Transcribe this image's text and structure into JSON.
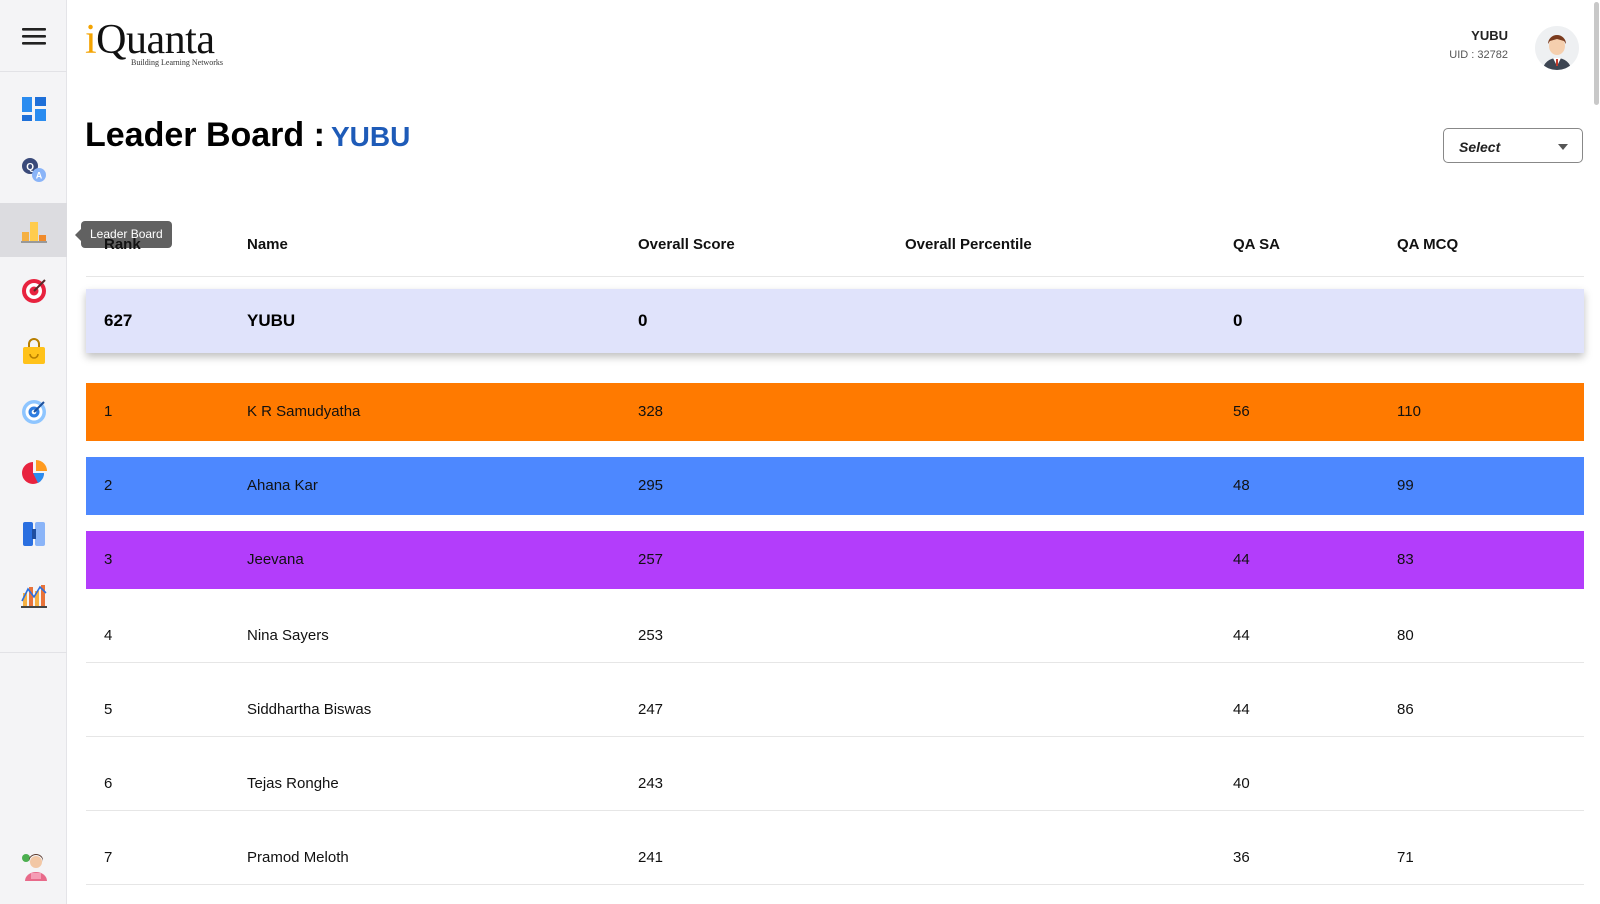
{
  "app": {
    "logo_letter": "i",
    "logo_rest": "Quanta",
    "logo_tagline": "Building Learning Networks"
  },
  "user": {
    "name": "YUBU",
    "uid": "UID : 32782"
  },
  "page": {
    "title": "Leader Board :",
    "user_label": "YUBU"
  },
  "filter": {
    "label": "Select"
  },
  "tooltip": "Leader Board",
  "colors": {
    "first": "#ff7a00",
    "second": "#4d88ff",
    "third": "#b33dfb",
    "accent": "#1e5bb8",
    "highlight": "#e0e3fb"
  },
  "columns": [
    "Rank",
    "Name",
    "Overall Score",
    "Overall Percentile",
    "QA SA",
    "QA MCQ"
  ],
  "my_row": {
    "rank": "627",
    "name": "YUBU",
    "score": "0",
    "percentile": "",
    "qa_sa": "0",
    "qa_mcq": ""
  },
  "rows": [
    {
      "rank": "1",
      "name": "K R Samudyatha",
      "score": "328",
      "percentile": "",
      "qa_sa": "56",
      "qa_mcq": "110"
    },
    {
      "rank": "2",
      "name": "Ahana Kar",
      "score": "295",
      "percentile": "",
      "qa_sa": "48",
      "qa_mcq": "99"
    },
    {
      "rank": "3",
      "name": "Jeevana",
      "score": "257",
      "percentile": "",
      "qa_sa": "44",
      "qa_mcq": "83"
    },
    {
      "rank": "4",
      "name": "Nina Sayers",
      "score": "253",
      "percentile": "",
      "qa_sa": "44",
      "qa_mcq": "80"
    },
    {
      "rank": "5",
      "name": "Siddhartha Biswas",
      "score": "247",
      "percentile": "",
      "qa_sa": "44",
      "qa_mcq": "86"
    },
    {
      "rank": "6",
      "name": "Tejas Ronghe",
      "score": "243",
      "percentile": "",
      "qa_sa": "40",
      "qa_mcq": ""
    },
    {
      "rank": "7",
      "name": "Pramod Meloth",
      "score": "241",
      "percentile": "",
      "qa_sa": "36",
      "qa_mcq": "71"
    }
  ],
  "sidebar": {
    "items": [
      {
        "icon": "dashboard-icon"
      },
      {
        "icon": "qa-icon"
      },
      {
        "icon": "leaderboard-icon"
      },
      {
        "icon": "target-icon"
      },
      {
        "icon": "shopping-bag-icon"
      },
      {
        "icon": "goal-icon"
      },
      {
        "icon": "pie-chart-icon"
      },
      {
        "icon": "book-icon"
      },
      {
        "icon": "analytics-icon"
      }
    ],
    "bottom_icon": "mentor-icon"
  }
}
